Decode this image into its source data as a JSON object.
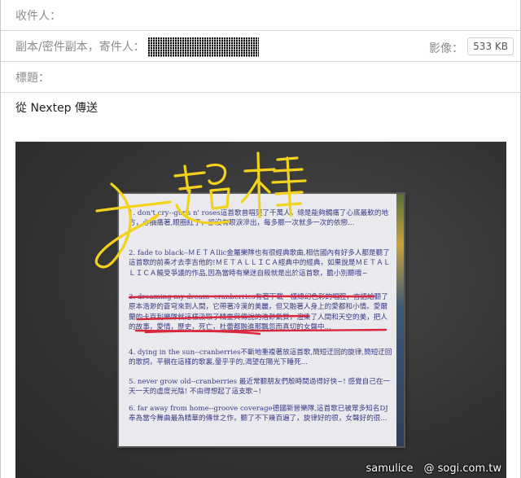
{
  "header": {
    "to_label": "收件人：",
    "cc_label": "副本/密件副本，寄件人：",
    "subject_label": "標題：",
    "image_label": "影像：",
    "image_size": "533 KB"
  },
  "body": {
    "signature": "從 Nextep 傳送"
  },
  "photo": {
    "handwriting": "女超棒",
    "paragraphs": [
      "1. don't cry--guns n' roses這首歌曾唱哭了千萬人。總是能夠觸痛了心底最軟的地方，心抽痛著,眼圈紅了，卻沒有眼淚滲出，每多聽一次就多一次的依戀...",
      "2. fade to black--ＭＥＴＡllic金屬樂隊也有很經典歌曲,相信國內有好多人都是聽了這首歌的前奏才去李吉他的!ＭＥＴＡＬＬＩＣＡ經典中的經典，如果說是ＭＥＴＡＬＬＩＣＡ饒受爭議的作品,因為當時有樂迷自殺就是出於這首歌，膽小別聽哦~",
      "3. dreaming my dream--cranberries有著下載一樣總幻色彩的唱腔，言語給聽了原本浩渺的蒼穹來到人間，它帶著冷漠的美麗，但又融著人身上的愛都和小情。愛爾蘭的卡百利樂隊就這樣汲取了精靈與傳說的浩渺氣質，渲染了人間和天空的美，把人的故事，愛情，歷史，死亡，杜蕾都融進那飄忽而真切的女聲中...",
      "4. dying in the sun--cranberries不斷地重複著放這首歌,簡短迂回的旋律,簡短迂回的歌詞，平躺在這樣的歌裏,暈乎乎的,渴望在陽光下睡死...",
      "5. never grow old--cranberries 最近常聽朋友們殷時間過得好快~! 感覺自己在一天一天的虛度光陰! 不由得想起了這支歌~!",
      "6. far away from home--groove coverage德國新晉樂隊,這首歌已被眾多知名DJ奉為當今舞曲最為精華的傳世之作，聽了不下幾百遍了，旋律好的很，女聲好的很..."
    ],
    "watermark": "samulice　@ sogi.com.tw"
  }
}
